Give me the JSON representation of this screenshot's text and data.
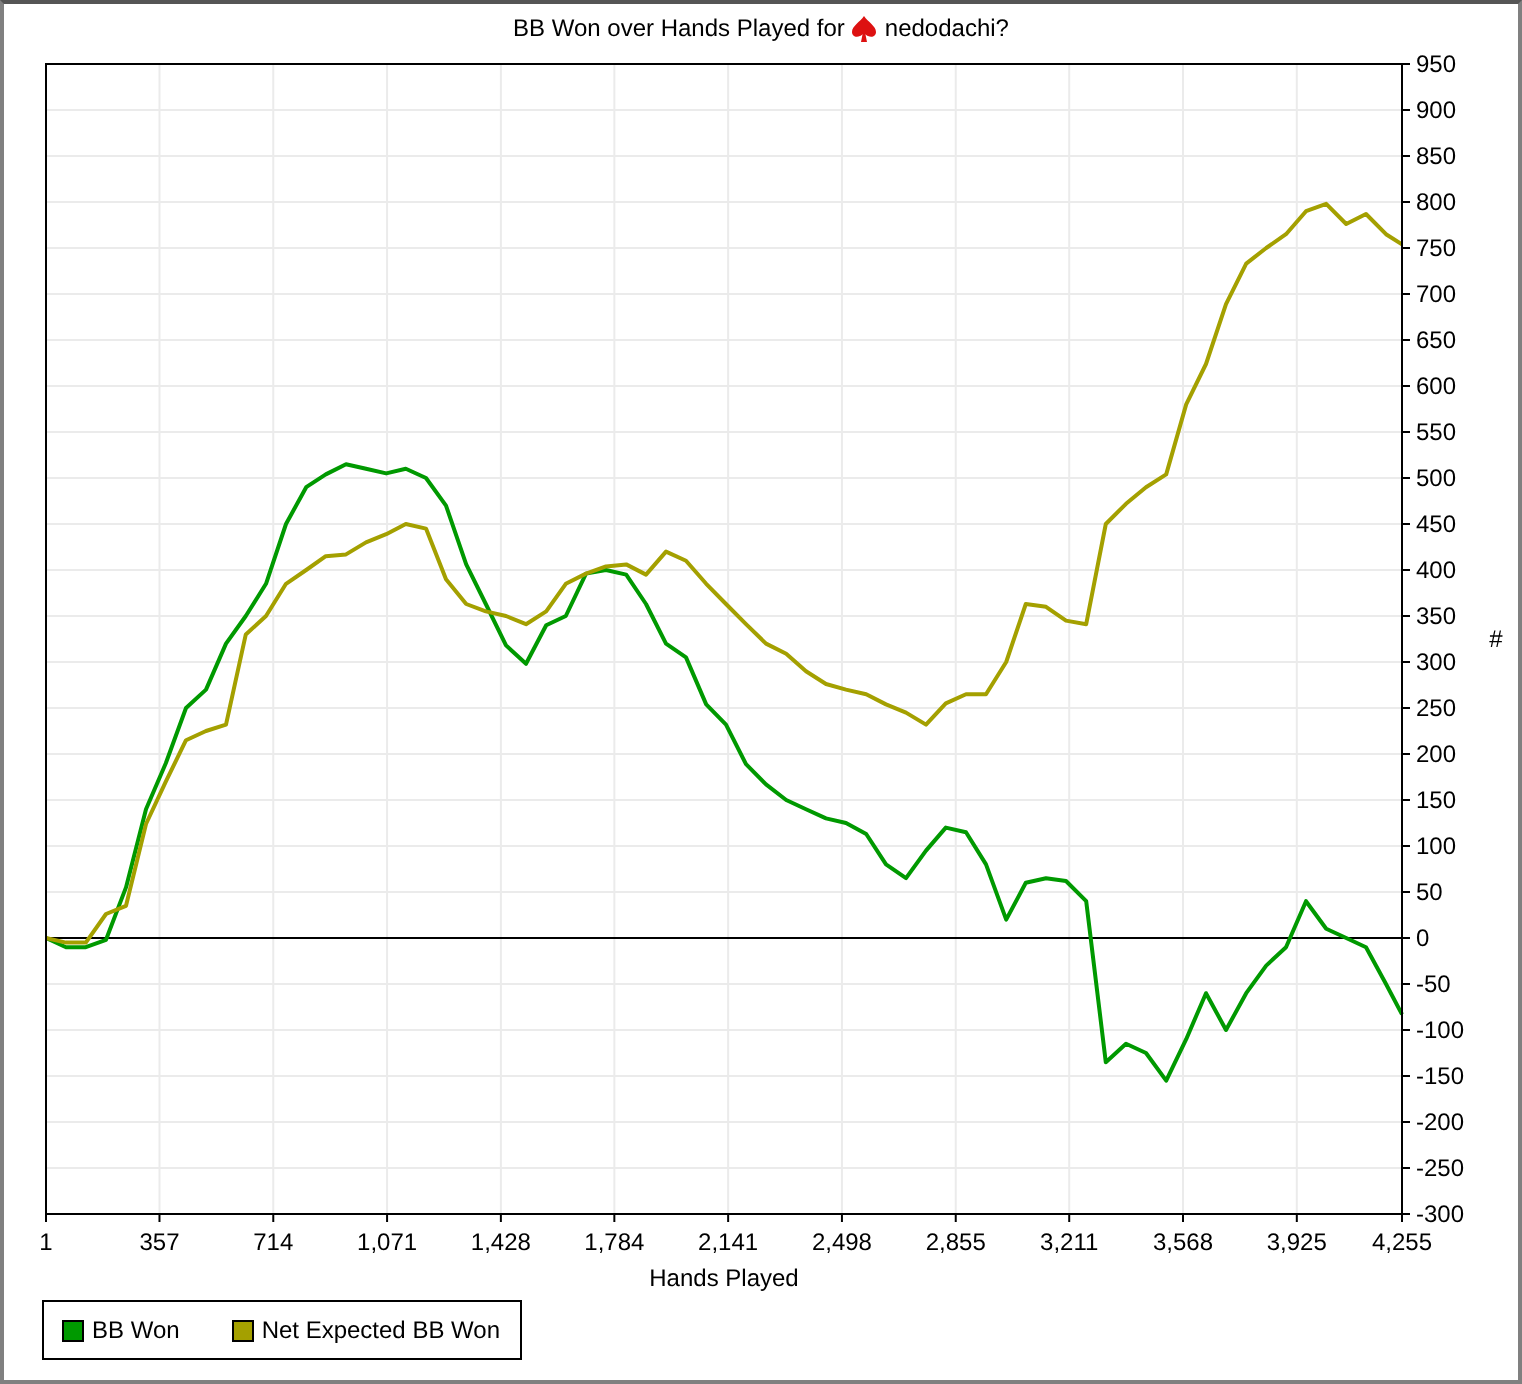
{
  "header": {
    "title": "BB Won over Hands Played for",
    "player": "nedodachi?"
  },
  "chart_data": {
    "type": "line",
    "xlabel": "Hands Played",
    "ylabel": "#",
    "x": [
      1,
      64,
      126,
      189,
      252,
      315,
      377,
      440,
      503,
      566,
      628,
      691,
      754,
      817,
      879,
      942,
      1005,
      1068,
      1130,
      1193,
      1256,
      1319,
      1381,
      1444,
      1507,
      1570,
      1632,
      1695,
      1758,
      1821,
      1883,
      1946,
      2009,
      2072,
      2134,
      2197,
      2260,
      2323,
      2385,
      2448,
      2511,
      2574,
      2636,
      2699,
      2762,
      2824,
      2887,
      2950,
      3013,
      3075,
      3138,
      3201,
      3264,
      3326,
      3389,
      3452,
      3515,
      3578,
      3640,
      3703,
      3766,
      3829,
      3891,
      3954,
      4017,
      4080,
      4142,
      4205,
      4255
    ],
    "series": [
      {
        "name": "BB Won",
        "color": "#009900",
        "values": [
          0,
          -10,
          -10,
          -2,
          55,
          140,
          190,
          250,
          270,
          320,
          350,
          385,
          450,
          490,
          504,
          515,
          510,
          505,
          510,
          500,
          470,
          406,
          363,
          318,
          298,
          340,
          350,
          396,
          400,
          395,
          363,
          320,
          305,
          254,
          232,
          189,
          167,
          150,
          140,
          130,
          125,
          113,
          80,
          65,
          95,
          120,
          115,
          80,
          20,
          60,
          65,
          62,
          40,
          -135,
          -115,
          -125,
          -155,
          -110,
          -60,
          -100,
          -60,
          -30,
          -10,
          40,
          10,
          0,
          -10,
          -50,
          -83
        ]
      },
      {
        "name": "Net Expected BB Won",
        "color": "#a4a000",
        "values": [
          0,
          -5,
          -5,
          26,
          35,
          124,
          170,
          215,
          225,
          232,
          330,
          350,
          385,
          400,
          415,
          417,
          430,
          439,
          450,
          445,
          390,
          363,
          355,
          350,
          341,
          355,
          385,
          396,
          404,
          406,
          395,
          420,
          410,
          385,
          363,
          341,
          320,
          309,
          290,
          276,
          270,
          265,
          254,
          245,
          232,
          255,
          265,
          265,
          300,
          363,
          360,
          345,
          341,
          450,
          472,
          490,
          504,
          580,
          624,
          689,
          733,
          750,
          765,
          790,
          798,
          776,
          787,
          765,
          754
        ]
      }
    ],
    "grid": true,
    "xlim": [
      1,
      4255
    ],
    "ylim": [
      -300,
      950
    ],
    "xticks": [
      {
        "value": 1,
        "label": "1"
      },
      {
        "value": 357,
        "label": "357"
      },
      {
        "value": 714,
        "label": "714"
      },
      {
        "value": 1071,
        "label": "1,071"
      },
      {
        "value": 1428,
        "label": "1,428"
      },
      {
        "value": 1784,
        "label": "1,784"
      },
      {
        "value": 2141,
        "label": "2,141"
      },
      {
        "value": 2498,
        "label": "2,498"
      },
      {
        "value": 2855,
        "label": "2,855"
      },
      {
        "value": 3211,
        "label": "3,211"
      },
      {
        "value": 3568,
        "label": "3,568"
      },
      {
        "value": 3925,
        "label": "3,925"
      },
      {
        "value": 4255,
        "label": "4,255"
      }
    ],
    "yticks": [
      -300,
      -250,
      -200,
      -150,
      -100,
      -50,
      0,
      50,
      100,
      150,
      200,
      250,
      300,
      350,
      400,
      450,
      500,
      550,
      600,
      650,
      700,
      750,
      800,
      850,
      900,
      950
    ]
  }
}
